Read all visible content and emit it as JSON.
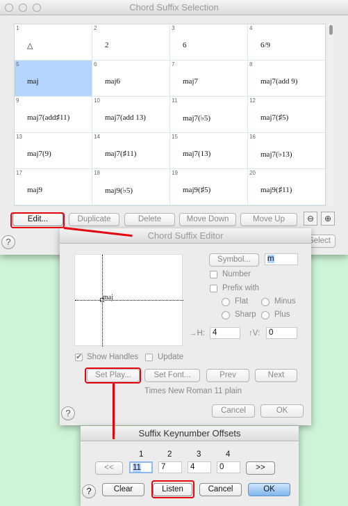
{
  "selection_window": {
    "title": "Chord Suffix Selection",
    "cells": [
      {
        "n": "1",
        "s": "△"
      },
      {
        "n": "2",
        "s": "2"
      },
      {
        "n": "3",
        "s": "6"
      },
      {
        "n": "4",
        "s": "6/9"
      },
      {
        "n": "5",
        "s": "maj",
        "selected": true
      },
      {
        "n": "6",
        "s": "maj6"
      },
      {
        "n": "7",
        "s": "maj7"
      },
      {
        "n": "8",
        "s": "maj7(add 9)"
      },
      {
        "n": "9",
        "s": "maj7(add♯11)"
      },
      {
        "n": "10",
        "s": "maj7(add 13)"
      },
      {
        "n": "11",
        "s": "maj7(♭5)"
      },
      {
        "n": "12",
        "s": "maj7(♯5)"
      },
      {
        "n": "13",
        "s": "maj7(9)"
      },
      {
        "n": "14",
        "s": "maj7(♯11)"
      },
      {
        "n": "15",
        "s": "maj7(13)"
      },
      {
        "n": "16",
        "s": "maj7(♭13)"
      },
      {
        "n": "17",
        "s": "maj9"
      },
      {
        "n": "18",
        "s": "maj9(♭5)"
      },
      {
        "n": "19",
        "s": "maj9(♯5)"
      },
      {
        "n": "20",
        "s": "maj9(♯11)"
      }
    ],
    "buttons": {
      "edit": "Edit...",
      "duplicate": "Duplicate",
      "delete": "Delete",
      "move_down": "Move Down",
      "move_up": "Move Up",
      "select": "Select"
    },
    "help": "?"
  },
  "editor_window": {
    "title": "Chord Suffix Editor",
    "preview_text": "maj",
    "symbol_button": "Symbol...",
    "symbol_value": "m",
    "number_label": "Number",
    "prefix_label": "Prefix with",
    "radios": {
      "flat": "Flat",
      "minus": "Minus",
      "sharp": "Sharp",
      "plus": "Plus"
    },
    "h_label": "→H:",
    "h_value": "4",
    "v_label": "↑V:",
    "v_value": "0",
    "show_handles_label": "Show Handles",
    "show_handles_checked": true,
    "update_label": "Update",
    "buttons": {
      "set_play": "Set Play...",
      "set_font": "Set Font...",
      "prev": "Prev",
      "next": "Next",
      "cancel": "Cancel",
      "ok": "OK"
    },
    "font_info": "Times New Roman 11 plain",
    "help": "?"
  },
  "offsets_window": {
    "title": "Suffix Keynumber Offsets",
    "column_labels": [
      "1",
      "2",
      "3",
      "4"
    ],
    "values": [
      "11",
      "7",
      "4",
      "0"
    ],
    "buttons": {
      "prev": "<<",
      "next": ">>",
      "clear": "Clear",
      "listen": "Listen",
      "cancel": "Cancel",
      "ok": "OK"
    },
    "help": "?"
  },
  "colors": {
    "highlight": "#e8000d",
    "selection": "#b4d5fe",
    "background": "#cdf4d6"
  }
}
